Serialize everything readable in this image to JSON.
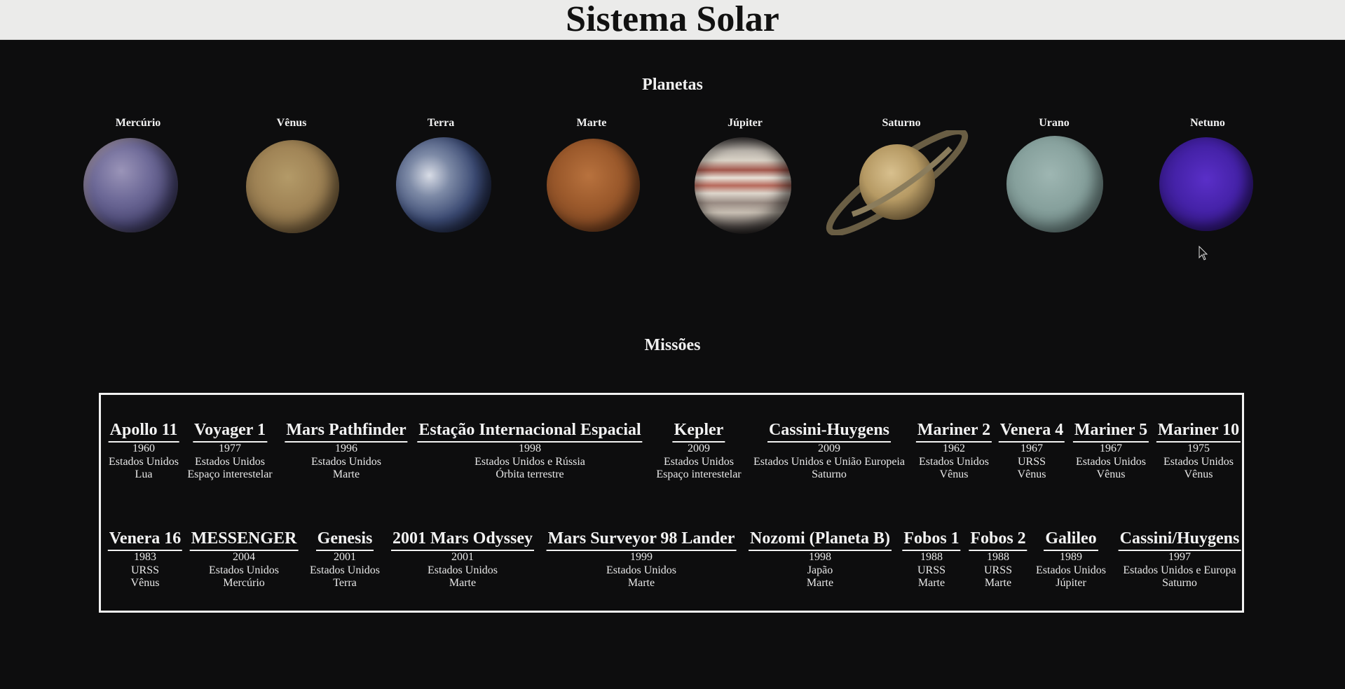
{
  "header": {
    "title": "Sistema Solar"
  },
  "planets_section": {
    "title": "Planetas",
    "items": [
      {
        "name": "Mercúrio"
      },
      {
        "name": "Vênus"
      },
      {
        "name": "Terra"
      },
      {
        "name": "Marte"
      },
      {
        "name": "Júpiter"
      },
      {
        "name": "Saturno"
      },
      {
        "name": "Urano"
      },
      {
        "name": "Netuno"
      }
    ]
  },
  "missions_section": {
    "title": "Missões",
    "row1": [
      {
        "name": "Apollo 11",
        "year": "1960",
        "country": "Estados Unidos",
        "target": "Lua"
      },
      {
        "name": "Voyager 1",
        "year": "1977",
        "country": "Estados Unidos",
        "target": "Espaço interestelar"
      },
      {
        "name": "Mars Pathfinder",
        "year": "1996",
        "country": "Estados Unidos",
        "target": "Marte"
      },
      {
        "name": "Estação Internacional Espacial",
        "year": "1998",
        "country": "Estados Unidos e Rússia",
        "target": "Órbita terrestre"
      },
      {
        "name": "Kepler",
        "year": "2009",
        "country": "Estados Unidos",
        "target": "Espaço interestelar"
      },
      {
        "name": "Cassini-Huygens",
        "year": "2009",
        "country": "Estados Unidos e União Europeia",
        "target": "Saturno"
      },
      {
        "name": "Mariner 2",
        "year": "1962",
        "country": "Estados Unidos",
        "target": "Vênus"
      },
      {
        "name": "Venera 4",
        "year": "1967",
        "country": "URSS",
        "target": "Vênus"
      },
      {
        "name": "Mariner 5",
        "year": "1967",
        "country": "Estados Unidos",
        "target": "Vênus"
      },
      {
        "name": "Mariner 10",
        "year": "1975",
        "country": "Estados Unidos",
        "target": "Vênus"
      }
    ],
    "row2": [
      {
        "name": "Venera 16",
        "year": "1983",
        "country": "URSS",
        "target": "Vênus"
      },
      {
        "name": "MESSENGER",
        "year": "2004",
        "country": "Estados Unidos",
        "target": "Mercúrio"
      },
      {
        "name": "Genesis",
        "year": "2001",
        "country": "Estados Unidos",
        "target": "Terra"
      },
      {
        "name": "2001 Mars Odyssey",
        "year": "2001",
        "country": "Estados Unidos",
        "target": "Marte"
      },
      {
        "name": "Mars Surveyor 98 Lander",
        "year": "1999",
        "country": "Estados Unidos",
        "target": "Marte"
      },
      {
        "name": "Nozomi (Planeta B)",
        "year": "1998",
        "country": "Japão",
        "target": "Marte"
      },
      {
        "name": "Fobos 1",
        "year": "1988",
        "country": "URSS",
        "target": "Marte"
      },
      {
        "name": "Fobos 2",
        "year": "1988",
        "country": "URSS",
        "target": "Marte"
      },
      {
        "name": "Galileo",
        "year": "1989",
        "country": "Estados Unidos",
        "target": "Júpiter"
      },
      {
        "name": "Cassini/Huygens",
        "year": "1997",
        "country": "Estados Unidos e Europa",
        "target": "Saturno"
      }
    ]
  }
}
